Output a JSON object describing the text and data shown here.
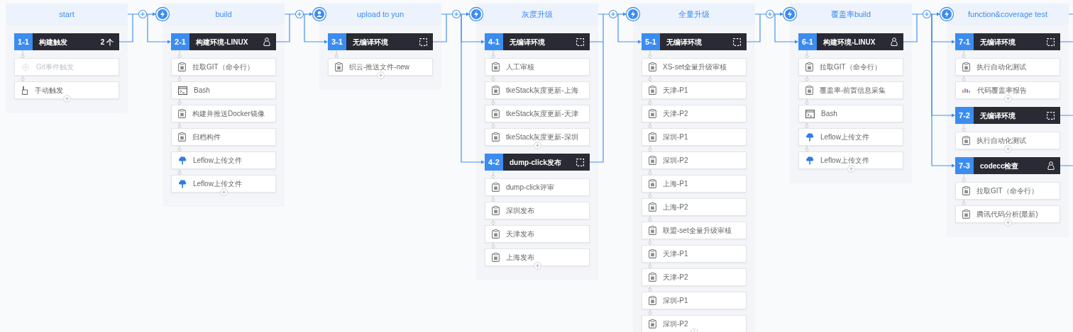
{
  "stages": [
    {
      "title": "start",
      "kind": "start",
      "jobs": [
        {
          "number": "1-1",
          "title": "构建触发",
          "kind": "trigger",
          "count": "2 个",
          "elements": [
            {
              "kind": "git-trigger",
              "label": "Git事件触发",
              "disabled": true
            },
            {
              "kind": "manual",
              "label": "手动触发",
              "disabled": false
            }
          ]
        }
      ]
    },
    {
      "title": "build",
      "kind": "auto",
      "jobs": [
        {
          "number": "2-1",
          "title": "构建环境-LINUX",
          "kind": "linux",
          "elements": [
            {
              "kind": "task",
              "label": "拉取GIT（命令行）"
            },
            {
              "kind": "bash",
              "label": "Bash"
            },
            {
              "kind": "task",
              "label": "构建并推送Docker镜像"
            },
            {
              "kind": "task",
              "label": "归档构件"
            },
            {
              "kind": "upload",
              "label": "Leflow上传文件"
            },
            {
              "kind": "upload",
              "label": "Leflow上传文件"
            }
          ]
        }
      ]
    },
    {
      "title": "upload to yun",
      "kind": "manual",
      "jobs": [
        {
          "number": "3-1",
          "title": "无编译环境",
          "kind": "blank",
          "elements": [
            {
              "kind": "task",
              "label": "织云-推送文件-new"
            }
          ]
        }
      ]
    },
    {
      "title": "灰度升级",
      "kind": "auto",
      "jobs": [
        {
          "number": "4-1",
          "title": "无编译环境",
          "kind": "blank",
          "elements": [
            {
              "kind": "task",
              "label": "人工审核"
            },
            {
              "kind": "task",
              "label": "tkeStack灰度更新-上海"
            },
            {
              "kind": "task",
              "label": "tkeStack灰度更新-天津"
            },
            {
              "kind": "task",
              "label": "tkeStack灰度更新-深圳"
            }
          ]
        },
        {
          "number": "4-2",
          "title": "dump-click发布",
          "kind": "blank",
          "elements": [
            {
              "kind": "task",
              "label": "dump-click评审"
            },
            {
              "kind": "task",
              "label": "深圳发布"
            },
            {
              "kind": "task",
              "label": "天津发布"
            },
            {
              "kind": "task",
              "label": "上海发布"
            }
          ]
        }
      ]
    },
    {
      "title": "全量升级",
      "kind": "auto",
      "jobs": [
        {
          "number": "5-1",
          "title": "无编译环境",
          "kind": "blank",
          "elements": [
            {
              "kind": "task",
              "label": "XS-set全量升级审核"
            },
            {
              "kind": "task",
              "label": "天津-P1"
            },
            {
              "kind": "task",
              "label": "天津-P2"
            },
            {
              "kind": "task",
              "label": "深圳-P1"
            },
            {
              "kind": "task",
              "label": "深圳-P2"
            },
            {
              "kind": "task",
              "label": "上海-P1"
            },
            {
              "kind": "task",
              "label": "上海-P2"
            },
            {
              "kind": "task",
              "label": "联盟-set全量升级审核"
            },
            {
              "kind": "task",
              "label": "天津-P1"
            },
            {
              "kind": "task",
              "label": "天津-P2"
            },
            {
              "kind": "task",
              "label": "深圳-P1"
            },
            {
              "kind": "task",
              "label": "深圳-P2"
            }
          ]
        }
      ]
    },
    {
      "title": "覆盖率build",
      "kind": "auto",
      "jobs": [
        {
          "number": "6-1",
          "title": "构建环境-LINUX",
          "kind": "linux",
          "elements": [
            {
              "kind": "task",
              "label": "拉取GIT（命令行）"
            },
            {
              "kind": "task",
              "label": "覆盖率-前置信息采集"
            },
            {
              "kind": "bash",
              "label": "Bash"
            },
            {
              "kind": "upload",
              "label": "Leflow上传文件"
            },
            {
              "kind": "upload",
              "label": "Leflow上传文件"
            }
          ]
        }
      ]
    },
    {
      "title": "function&coverage test",
      "kind": "auto",
      "jobs": [
        {
          "number": "7-1",
          "title": "无编译环境",
          "kind": "blank",
          "elements": [
            {
              "kind": "task",
              "label": "执行自动化测试"
            },
            {
              "kind": "report",
              "label": "代码覆盖率报告"
            }
          ]
        },
        {
          "number": "7-2",
          "title": "无编译环境",
          "kind": "blank",
          "elements": [
            {
              "kind": "task",
              "label": "执行自动化测试"
            }
          ]
        },
        {
          "number": "7-3",
          "title": "codecc检查",
          "kind": "linux",
          "elements": [
            {
              "kind": "task",
              "label": "拉取GIT（命令行）"
            },
            {
              "kind": "task",
              "label": "腾讯代码分析(最新)"
            }
          ]
        }
      ]
    }
  ]
}
